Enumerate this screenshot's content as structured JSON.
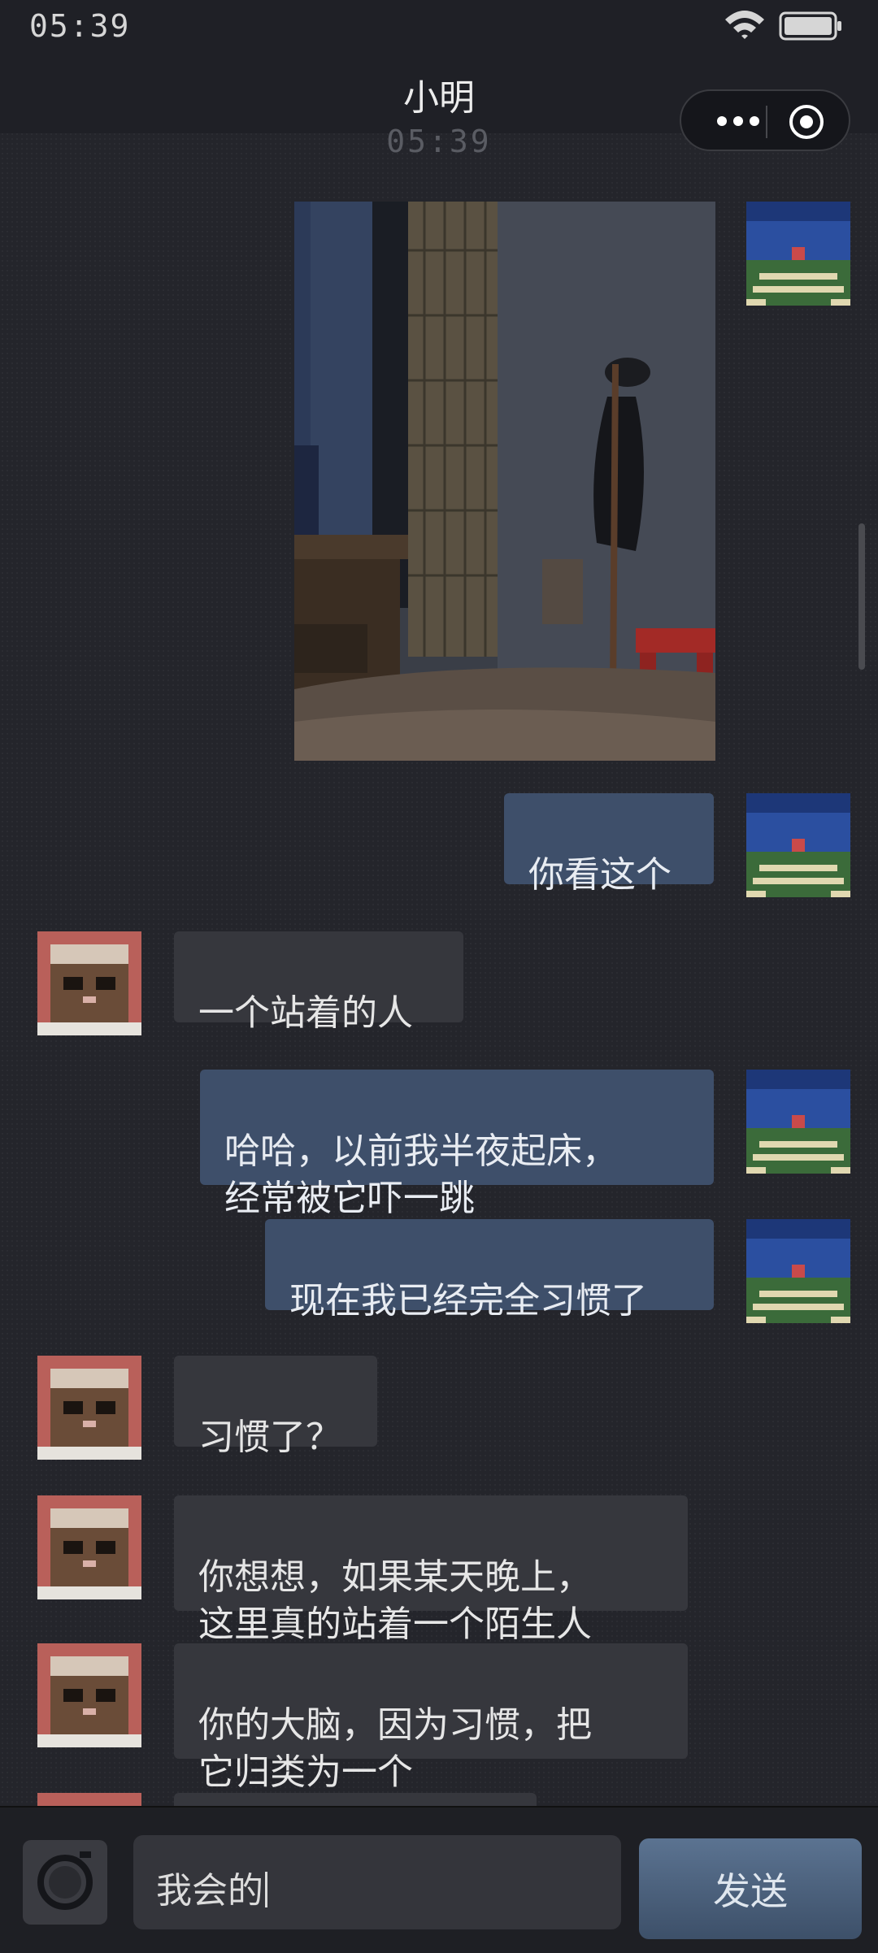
{
  "status_bar": {
    "time": "05:39",
    "wifi_icon": "wifi-icon",
    "battery_icon": "battery-icon"
  },
  "nav": {
    "title": "小明",
    "more_icon": "more-dots-icon",
    "close_icon": "target-icon"
  },
  "chat": {
    "timestamp": "05:39",
    "messages": [
      {
        "side": "right",
        "type": "image",
        "text": ""
      },
      {
        "side": "right",
        "type": "text",
        "text": "你看这个"
      },
      {
        "side": "left",
        "type": "text",
        "text": "一个站着的人"
      },
      {
        "side": "right",
        "type": "text",
        "text": "哈哈，以前我半夜起床，\n经常被它吓一跳"
      },
      {
        "side": "right",
        "type": "text",
        "text": "现在我已经完全习惯了"
      },
      {
        "side": "left",
        "type": "text",
        "text": "习惯了？"
      },
      {
        "side": "left",
        "type": "text",
        "text": "你想想，如果某天晚上，\n这里真的站着一个陌生人"
      },
      {
        "side": "left",
        "type": "text",
        "text": "你的大脑，因为习惯，把\n它归类为一个"
      }
    ]
  },
  "input": {
    "value": "我会的",
    "camera_icon": "camera-icon",
    "send_label": "发送"
  },
  "colors": {
    "right_bubble": "#3e4f6a",
    "left_bubble": "#36373d",
    "background": "#24252b",
    "send_button": "#4f6683"
  }
}
